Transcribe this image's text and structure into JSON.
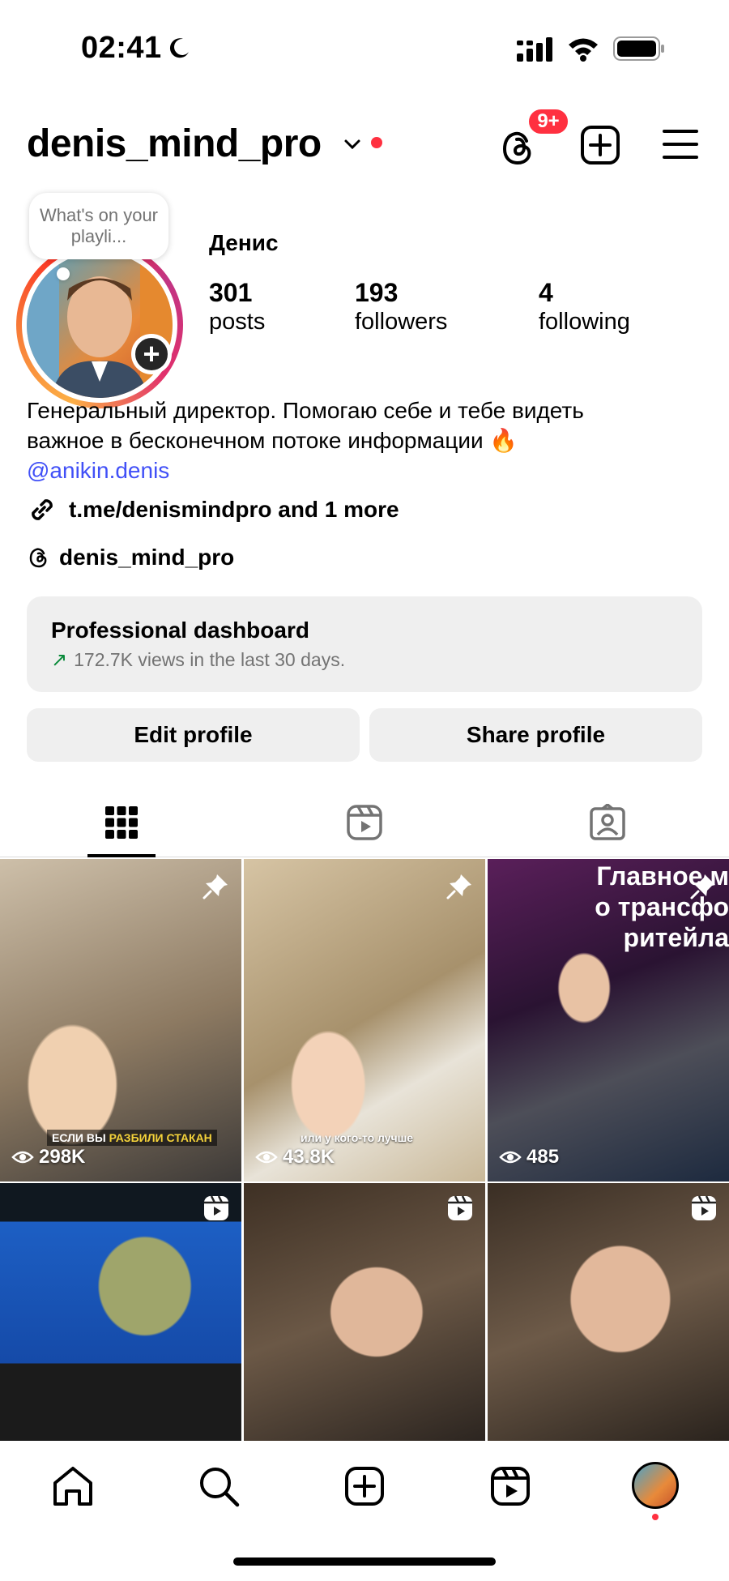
{
  "status_bar": {
    "time": "02:41",
    "icons": [
      "moon-icon",
      "signal-icon",
      "wifi-icon",
      "battery-icon"
    ]
  },
  "header": {
    "username": "denis_mind_pro",
    "notification_badge": "9+",
    "icons": [
      "chevron-down-icon",
      "threads-icon",
      "add-post-icon",
      "menu-icon"
    ]
  },
  "profile": {
    "note": "What's on your playli...",
    "display_name": "Денис",
    "stats": [
      {
        "value": "301",
        "label": "posts"
      },
      {
        "value": "193",
        "label": "followers"
      },
      {
        "value": "4",
        "label": "following"
      }
    ],
    "bio_line1": "Генеральный директор. Помогаю себе и тебе видеть",
    "bio_line2": "важное в бесконечном потоке информации 🔥",
    "mention": "@anikin.denis",
    "link": "t.me/denismindpro and 1 more",
    "threads_handle": "denis_mind_pro"
  },
  "dashboard": {
    "title": "Professional dashboard",
    "subtitle": "172.7K views in the last 30 days.",
    "accent": "#0a8a3a"
  },
  "buttons": {
    "edit": "Edit profile",
    "share": "Share profile"
  },
  "tabs": [
    "grid-icon",
    "reels-icon",
    "tagged-icon"
  ],
  "grid": [
    {
      "views": "298K",
      "badge": "pin-icon",
      "caption_plain": "ЕСЛИ ВЫ",
      "caption_highlight": "РАЗБИЛИ СТАКАН"
    },
    {
      "views": "43.8K",
      "badge": "pin-icon",
      "caption": "или у кого-то лучше"
    },
    {
      "views": "485",
      "badge": "pin-icon",
      "overlay": "Главное м\nо трансфо\nритейла"
    },
    {
      "badge": "reel-icon"
    },
    {
      "badge": "reel-icon"
    },
    {
      "badge": "reel-icon"
    }
  ],
  "bottom_nav": [
    "home-icon",
    "search-icon",
    "create-icon",
    "reels-icon",
    "profile-avatar"
  ],
  "colors": {
    "brand_red": "#ff3040",
    "mention_blue": "#4150f7",
    "button_bg": "#efefef"
  }
}
